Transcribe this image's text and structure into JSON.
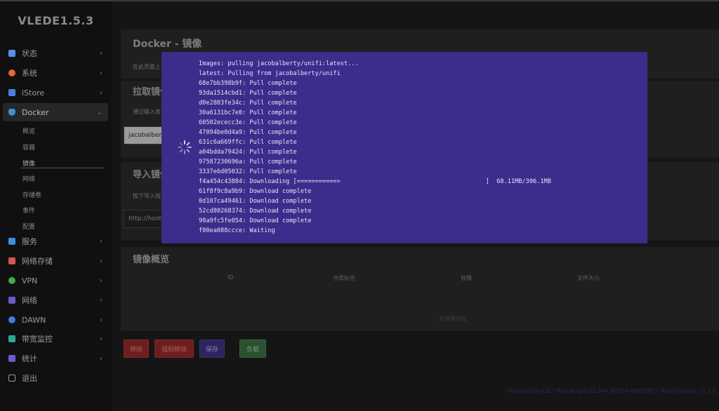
{
  "app": {
    "logo": "VLEDE1.5.3"
  },
  "sidebar": {
    "items": [
      {
        "label": "状态",
        "icon": "grid-icon",
        "color": "#5b8def"
      },
      {
        "label": "系统",
        "icon": "gear-icon",
        "color": "#e8643a"
      },
      {
        "label": "iStore",
        "icon": "cube-icon",
        "color": "#4a7fe0"
      },
      {
        "label": "Docker",
        "icon": "docker-icon",
        "color": "#3d8fd6"
      },
      {
        "label": "服务",
        "icon": "puzzle-icon",
        "color": "#3a8fe0"
      },
      {
        "label": "网络存储",
        "icon": "disk-icon",
        "color": "#d9534f"
      },
      {
        "label": "VPN",
        "icon": "globe-icon",
        "color": "#3fae49"
      },
      {
        "label": "网络",
        "icon": "network-icon",
        "color": "#6f58c9"
      },
      {
        "label": "DAWN",
        "icon": "globe-icon",
        "color": "#3c7dd9"
      },
      {
        "label": "带宽监控",
        "icon": "monitor-icon",
        "color": "#2faa8f"
      },
      {
        "label": "统计",
        "icon": "chart-icon",
        "color": "#6f58c9"
      },
      {
        "label": "退出",
        "icon": "logout-icon",
        "color": "#999999"
      }
    ],
    "docker_sub": [
      "概览",
      "容器",
      "镜像",
      "网络",
      "存储卷",
      "事件",
      "配置"
    ]
  },
  "main": {
    "page_title": "Docker - 镜像",
    "page_desc": "在此页面上",
    "pull_title": "拉取镜像",
    "pull_desc": "通过输入库",
    "pull_input_value": "jacobalberty",
    "import_title": "导入镜像",
    "import_desc": "按下导入按",
    "import_placeholder": "http://host",
    "overview_title": "镜像概览",
    "table_headers": [
      "ID",
      "仓库标签",
      "容器",
      "文件大小"
    ],
    "empty_text": "无镜像存在",
    "buttons": {
      "remove": "移除",
      "force_remove": "强制移除",
      "save": "保存",
      "load": "负载"
    },
    "footer": "Powered by LuCI Master (git-22.244.49204-9d8b5f8) / ArgonTheme v1.7.2"
  },
  "modal": {
    "log_lines": [
      "Images: pulling jacobalberty/unifi:latest...",
      "latest: Pulling from jacobalberty/unifi",
      "68e7bb398b9f: Pull complete",
      "93da1514cbd1: Pull complete",
      "d0e2803fe34c: Pull complete",
      "30a6131bc7e0: Pull complete",
      "60502ececc3e: Pull complete",
      "47094be0d4a9: Pull complete",
      "631c6a669ffc: Pull complete",
      "a04bdda79424: Pull complete",
      "97587230696a: Pull complete",
      "3337e6d05032: Pull complete",
      "f4a454c43884: Downloading [===========>                                        ]  68.11MB/306.1MB",
      "61f8f9c8a9b9: Download complete",
      "0d107ca49461: Download complete",
      "52cd80268374: Download complete",
      "98a9fc5fe054: Download complete",
      "f00ea088ccce: Waiting"
    ]
  },
  "colors": {
    "modal_bg": "#3d2c8c",
    "remove_btn": "#6e1e1e",
    "force_remove_btn": "#6e1e1e",
    "save_btn": "#2c2560",
    "load_btn": "#2a5230"
  }
}
